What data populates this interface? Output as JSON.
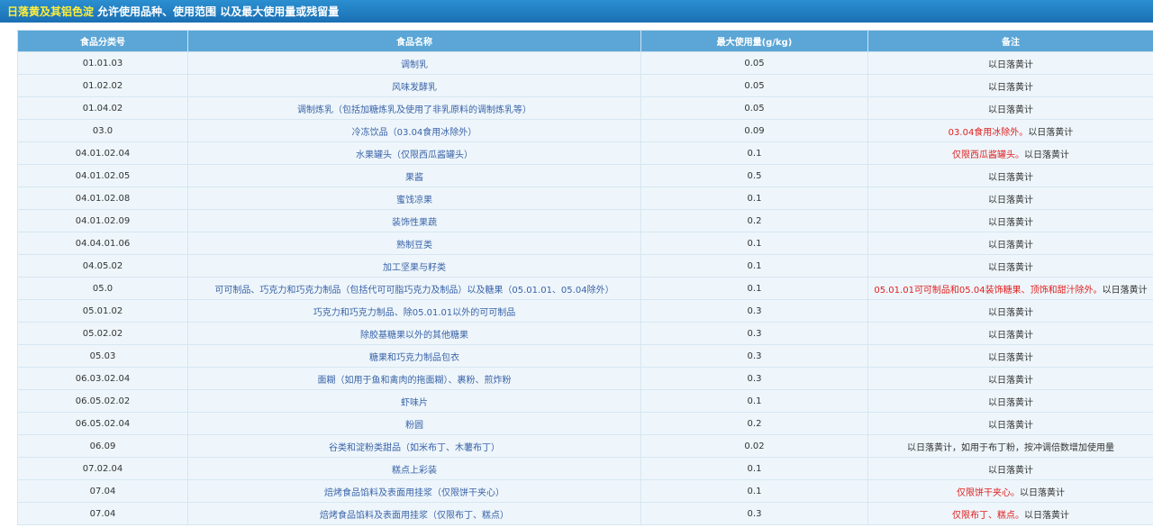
{
  "header": {
    "title_highlight": "日落黄及其铝色淀",
    "title_rest": "允许使用品种、使用范围 以及最大使用量或残留量"
  },
  "table": {
    "columns": [
      "食品分类号",
      "食品名称",
      "最大使用量(g/kg)",
      "备注"
    ],
    "rows": [
      {
        "code": "01.01.03",
        "name": "调制乳",
        "max": "0.05",
        "note_red": "",
        "note": "以日落黄计"
      },
      {
        "code": "01.02.02",
        "name": "风味发酵乳",
        "max": "0.05",
        "note_red": "",
        "note": "以日落黄计"
      },
      {
        "code": "01.04.02",
        "name": "调制炼乳（包括加糖炼乳及使用了非乳原料的调制炼乳等）",
        "max": "0.05",
        "note_red": "",
        "note": "以日落黄计"
      },
      {
        "code": "03.0",
        "name": "冷冻饮品（03.04食用冰除外）",
        "max": "0.09",
        "note_red": "03.04食用冰除外。",
        "note": "以日落黄计"
      },
      {
        "code": "04.01.02.04",
        "name": "水果罐头（仅限西瓜酱罐头）",
        "max": "0.1",
        "note_red": "仅限西瓜酱罐头。",
        "note": "以日落黄计"
      },
      {
        "code": "04.01.02.05",
        "name": "果酱",
        "max": "0.5",
        "note_red": "",
        "note": "以日落黄计"
      },
      {
        "code": "04.01.02.08",
        "name": "蜜饯凉果",
        "max": "0.1",
        "note_red": "",
        "note": "以日落黄计"
      },
      {
        "code": "04.01.02.09",
        "name": "装饰性果蔬",
        "max": "0.2",
        "note_red": "",
        "note": "以日落黄计"
      },
      {
        "code": "04.04.01.06",
        "name": "熟制豆类",
        "max": "0.1",
        "note_red": "",
        "note": "以日落黄计"
      },
      {
        "code": "04.05.02",
        "name": "加工坚果与籽类",
        "max": "0.1",
        "note_red": "",
        "note": "以日落黄计"
      },
      {
        "code": "05.0",
        "name": "可可制品、巧克力和巧克力制品（包括代可可脂巧克力及制品）以及糖果（05.01.01、05.04除外）",
        "max": "0.1",
        "note_red": "05.01.01可可制品和05.04装饰糖果、顶饰和甜汁除外。",
        "note": "以日落黄计"
      },
      {
        "code": "05.01.02",
        "name": "巧克力和巧克力制品、除05.01.01以外的可可制品",
        "max": "0.3",
        "note_red": "",
        "note": "以日落黄计"
      },
      {
        "code": "05.02.02",
        "name": "除胶基糖果以外的其他糖果",
        "max": "0.3",
        "note_red": "",
        "note": "以日落黄计"
      },
      {
        "code": "05.03",
        "name": "糖果和巧克力制品包衣",
        "max": "0.3",
        "note_red": "",
        "note": "以日落黄计"
      },
      {
        "code": "06.03.02.04",
        "name": "面糊（如用于鱼和禽肉的拖面糊）、裹粉、煎炸粉",
        "max": "0.3",
        "note_red": "",
        "note": "以日落黄计"
      },
      {
        "code": "06.05.02.02",
        "name": "虾味片",
        "max": "0.1",
        "note_red": "",
        "note": "以日落黄计"
      },
      {
        "code": "06.05.02.04",
        "name": "粉圆",
        "max": "0.2",
        "note_red": "",
        "note": "以日落黄计"
      },
      {
        "code": "06.09",
        "name": "谷类和淀粉类甜品（如米布丁、木薯布丁）",
        "max": "0.02",
        "note_red": "",
        "note": "以日落黄计，如用于布丁粉，按冲调倍数增加使用量"
      },
      {
        "code": "07.02.04",
        "name": "糕点上彩装",
        "max": "0.1",
        "note_red": "",
        "note": "以日落黄计"
      },
      {
        "code": "07.04",
        "name": "焙烤食品馅料及表面用挂浆（仅限饼干夹心）",
        "max": "0.1",
        "note_red": "仅限饼干夹心。",
        "note": "以日落黄计"
      },
      {
        "code": "07.04",
        "name": "焙烤食品馅料及表面用挂浆（仅限布丁、糕点）",
        "max": "0.3",
        "note_red": "仅限布丁、糕点。",
        "note": "以日落黄计"
      }
    ]
  }
}
